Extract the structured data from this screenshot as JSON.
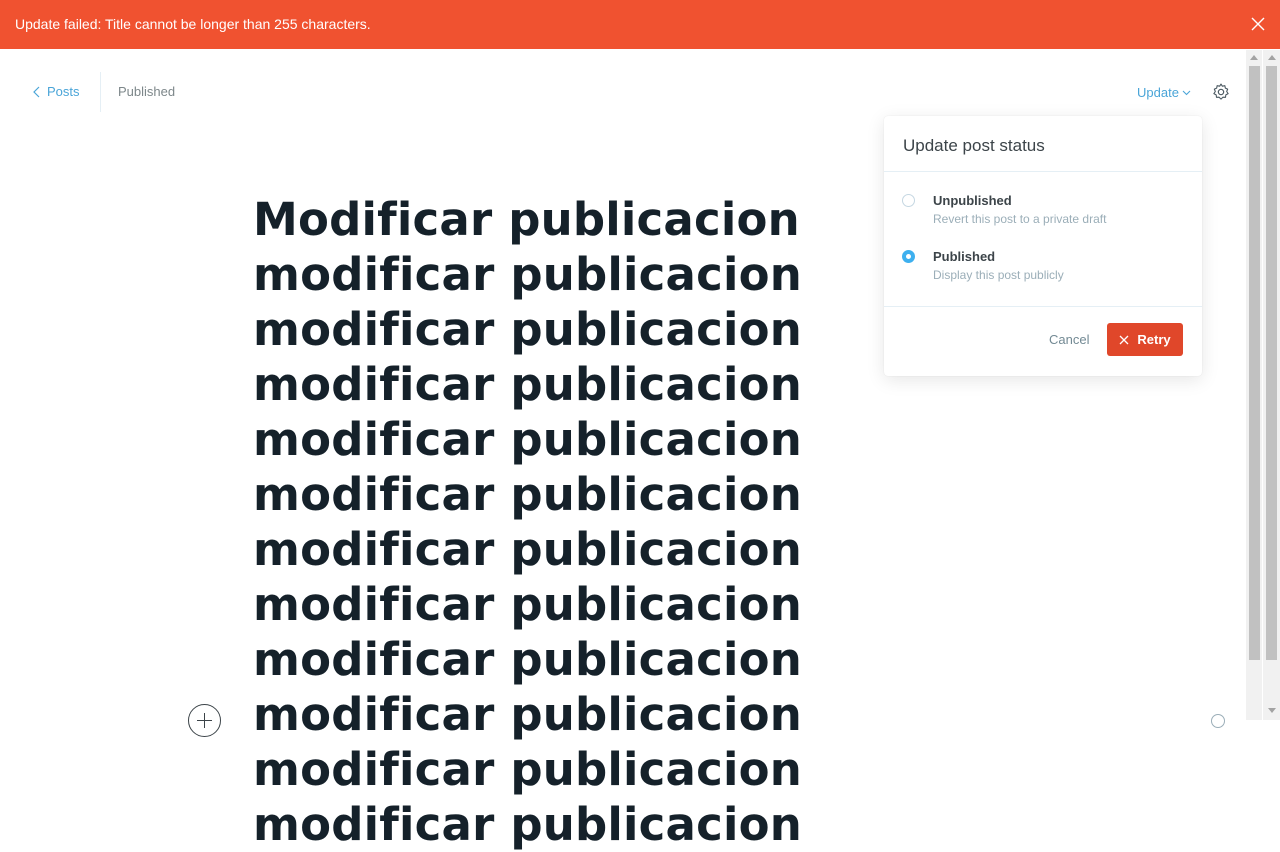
{
  "alert": {
    "message": "Update failed: Title cannot be longer than 255 characters.",
    "close_icon": "close-icon",
    "color": "#f05230"
  },
  "header": {
    "back_label": "Posts",
    "status": "Published",
    "update_label": "Update",
    "settings_icon": "gear-icon"
  },
  "post": {
    "title": "Modificar publicacion modificar publicacion modificar publicacion modificar publicacion modificar publicacion modificar publicacion modificar publicacion modificar publicacion modificar publicacion modificar publicacion modificar publicacion modificar publicacion"
  },
  "popover": {
    "title": "Update post status",
    "options": [
      {
        "label": "Unpublished",
        "description": "Revert this post to a private draft",
        "selected": false
      },
      {
        "label": "Published",
        "description": "Display this post publicly",
        "selected": true
      }
    ],
    "cancel_label": "Cancel",
    "retry_label": "Retry",
    "retry_color": "#e0472a",
    "accent": "#3eb0ef"
  }
}
